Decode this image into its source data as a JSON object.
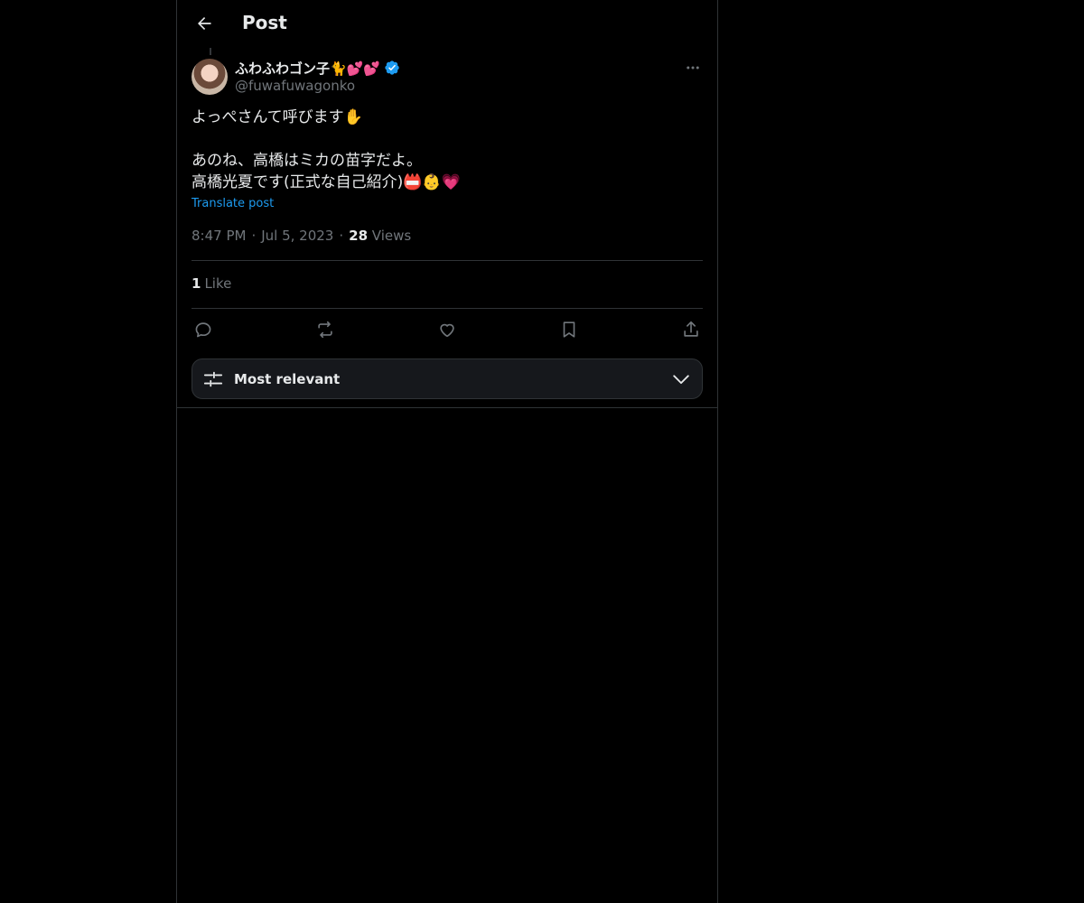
{
  "header": {
    "title": "Post"
  },
  "post": {
    "author": {
      "display_name": "ふわふわゴン子🐈💕💕",
      "handle": "@fuwafuwagonko"
    },
    "text_lines": [
      "よっぺさんて呼びます✋",
      "あのね、高橋はミカの苗字だよ。",
      "高橋光夏です(正式な自己紹介)📛👶💗"
    ],
    "translate_label": "Translate post",
    "time": "8:47 PM",
    "date": "Jul 5, 2023",
    "views_count": "28",
    "views_label": "Views",
    "likes_count": "1",
    "likes_label": "Like"
  },
  "sort": {
    "label": "Most relevant"
  },
  "icons": {
    "back": "arrow-left-icon",
    "more": "more-horizontal-icon",
    "verified": "verified-badge-icon",
    "reply": "reply-icon",
    "repost": "repost-icon",
    "like": "heart-icon",
    "bookmark": "bookmark-icon",
    "share": "share-icon",
    "filter": "sliders-icon",
    "chevron": "chevron-down-icon"
  },
  "colors": {
    "accent": "#1d9bf0",
    "background": "#000000",
    "secondary_text": "#71767b"
  }
}
